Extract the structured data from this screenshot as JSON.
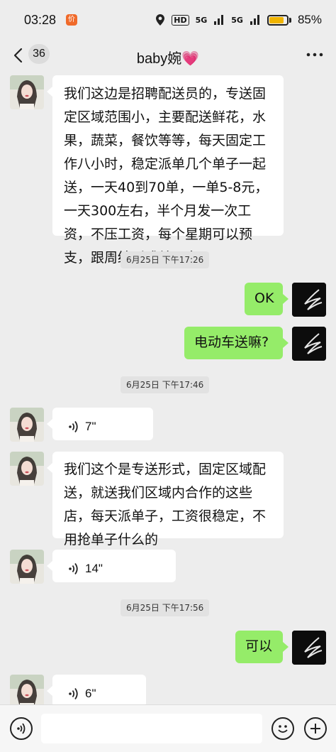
{
  "status_bar": {
    "time": "03:28",
    "app_badge": "价",
    "hd": "HD",
    "signal_1": "5G",
    "signal_2": "5G",
    "battery_level": 0.85,
    "battery_text": "85%"
  },
  "header": {
    "back_icon": "chevron-left-icon",
    "unread_count": "36",
    "title": "baby婉💗",
    "more_icon": "more-icon"
  },
  "messages": [
    {
      "side": "in",
      "type": "text",
      "text": "我们这边是招聘配送员的，专送固定区域范围小，主要配送鲜花，水果，蔬菜，餐饮等等，每天固定工作八小时，稳定派单几个单子一起送，一天40到70单，一单5-8元，一天300左右，半个月发一次工资，不压工资，每个星期可以预支，跟周结形式差不多"
    },
    {
      "type": "time",
      "text": "6月25日 下午17:26"
    },
    {
      "side": "out",
      "type": "text",
      "text": "OK"
    },
    {
      "side": "out",
      "type": "text",
      "text": "电动车送嘛?"
    },
    {
      "type": "time",
      "text": "6月25日 下午17:46"
    },
    {
      "side": "in",
      "type": "voice",
      "text": "7\""
    },
    {
      "side": "in",
      "type": "text",
      "text": "我们这个是专送形式，固定区域配送，就送我们区域内合作的这些店，每天派单子，工资很稳定，不用抢单子什么的"
    },
    {
      "side": "in",
      "type": "voice",
      "text": "14\""
    },
    {
      "type": "time",
      "text": "6月25日 下午17:56"
    },
    {
      "side": "out",
      "type": "text",
      "text": "可以"
    },
    {
      "side": "in",
      "type": "voice",
      "text": "6\""
    }
  ],
  "bottom_bar": {
    "voice_icon": "voice-mode-icon",
    "emoji_icon": "emoji-icon",
    "plus_icon": "plus-icon",
    "input_value": ""
  },
  "colors": {
    "background": "#ededed",
    "bubble_in": "#ffffff",
    "bubble_out": "#95ec69",
    "timestamp_bg": "#e2e2e2"
  }
}
